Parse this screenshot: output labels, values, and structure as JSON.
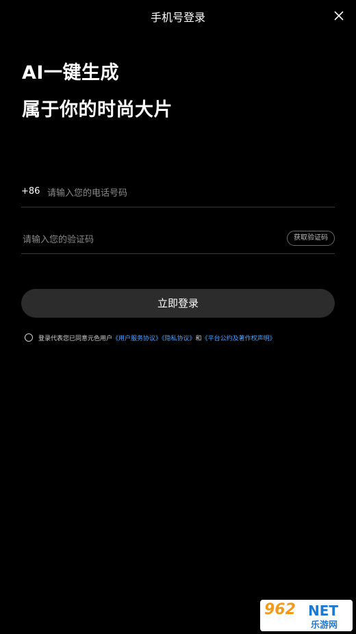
{
  "header": {
    "title": "手机号登录",
    "close_icon": "close-icon"
  },
  "hero": {
    "line1": "AI一键生成",
    "line2": "属于你的时尚大片"
  },
  "phone": {
    "country_code": "+86",
    "placeholder": "请输入您的电话号码",
    "value": ""
  },
  "code": {
    "placeholder": "请输入您的验证码",
    "value": "",
    "get_code_label": "获取验证码"
  },
  "login_button": {
    "label": "立即登录"
  },
  "agreement": {
    "checked": false,
    "prefix": "登录代表您已同意元色用户",
    "link1": "《用户服务协议》",
    "link2": "《隐私协议》",
    "conj": "和",
    "link3": "《平台公约及著作权声明》"
  },
  "watermark": {
    "number": "962",
    "net": "NET",
    "site": "乐游网"
  },
  "colors": {
    "background": "#000000",
    "button": "#2c2c2c",
    "link": "#4aa3ff"
  }
}
